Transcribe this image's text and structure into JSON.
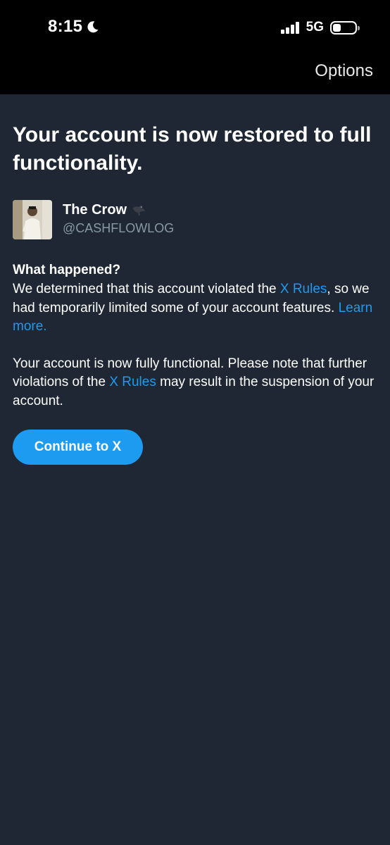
{
  "status_bar": {
    "time": "8:15",
    "network": "5G",
    "icons": [
      "moon-icon",
      "signal-icon",
      "battery-icon"
    ]
  },
  "header": {
    "options_label": "Options"
  },
  "main": {
    "title": "Your account is now restored to full functionality.",
    "profile": {
      "display_name": "The Crow",
      "handle": "@CASHFLOWLOG",
      "name_icon": "bird-icon"
    },
    "section_heading": "What happened?",
    "paragraph1": {
      "text_a": "We determined that this account violated the ",
      "link_a": "X Rules",
      "text_b": ", so we had temporarily limited some of your account features. ",
      "link_b": "Learn more."
    },
    "paragraph2": {
      "text_a": "Your account is now fully functional. Please note that further violations of the ",
      "link_a": "X Rules",
      "text_b": " may result in the suspension of your account."
    },
    "continue_label": "Continue to X"
  },
  "colors": {
    "background": "#1e2733",
    "topbar": "#000000",
    "link": "#1d9bf0",
    "button": "#1d9bf0",
    "secondary_text": "#8899a6"
  }
}
